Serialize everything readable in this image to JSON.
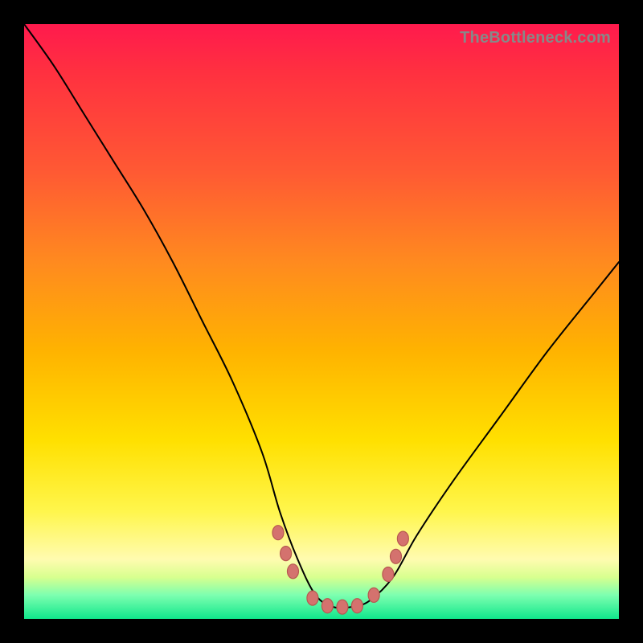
{
  "watermark": "TheBottleneck.com",
  "colors": {
    "page_bg": "#000000",
    "curve_stroke": "#000000",
    "marker_fill": "#d4726e",
    "marker_stroke": "#b75850",
    "watermark_text": "#888888"
  },
  "chart_data": {
    "type": "line",
    "title": "",
    "xlabel": "",
    "ylabel": "",
    "xlim": [
      0,
      1
    ],
    "ylim": [
      0,
      1
    ],
    "grid": false,
    "legend": false,
    "series": [
      {
        "name": "bottleneck-curve",
        "x": [
          0.0,
          0.05,
          0.1,
          0.15,
          0.2,
          0.25,
          0.3,
          0.35,
          0.4,
          0.43,
          0.46,
          0.49,
          0.52,
          0.55,
          0.58,
          0.62,
          0.66,
          0.72,
          0.8,
          0.88,
          0.96,
          1.0
        ],
        "values": [
          1.0,
          0.93,
          0.85,
          0.77,
          0.69,
          0.6,
          0.5,
          0.4,
          0.28,
          0.18,
          0.1,
          0.04,
          0.02,
          0.02,
          0.03,
          0.07,
          0.14,
          0.23,
          0.34,
          0.45,
          0.55,
          0.6
        ]
      }
    ],
    "markers": [
      {
        "x": 0.427,
        "y": 0.145
      },
      {
        "x": 0.44,
        "y": 0.11
      },
      {
        "x": 0.452,
        "y": 0.08
      },
      {
        "x": 0.485,
        "y": 0.035
      },
      {
        "x": 0.51,
        "y": 0.022
      },
      {
        "x": 0.535,
        "y": 0.02
      },
      {
        "x": 0.56,
        "y": 0.022
      },
      {
        "x": 0.588,
        "y": 0.04
      },
      {
        "x": 0.612,
        "y": 0.075
      },
      {
        "x": 0.625,
        "y": 0.105
      },
      {
        "x": 0.637,
        "y": 0.135
      }
    ],
    "annotation": {
      "text": "",
      "x": 0.645,
      "y": 0.152
    }
  }
}
